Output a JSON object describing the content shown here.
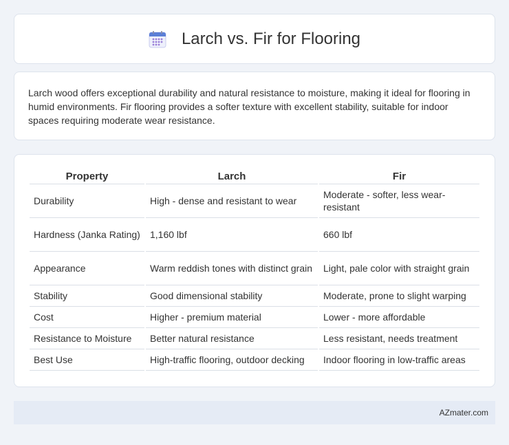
{
  "header": {
    "title": "Larch vs. Fir for Flooring",
    "icon": "calendar-icon"
  },
  "intro": {
    "text": "Larch wood offers exceptional durability and natural resistance to moisture, making it ideal for flooring in humid environments. Fir flooring provides a softer texture with excellent stability, suitable for indoor spaces requiring moderate wear resistance."
  },
  "table": {
    "headers": [
      "Property",
      "Larch",
      "Fir"
    ],
    "rows": [
      {
        "property": "Durability",
        "larch": "High - dense and resistant to wear",
        "fir": "Moderate - softer, less wear-resistant"
      },
      {
        "property": "Hardness (Janka Rating)",
        "larch": "1,160 lbf",
        "fir": "660 lbf"
      },
      {
        "property": "Appearance",
        "larch": "Warm reddish tones with distinct grain",
        "fir": "Light, pale color with straight grain"
      },
      {
        "property": "Stability",
        "larch": "Good dimensional stability",
        "fir": "Moderate, prone to slight warping"
      },
      {
        "property": "Cost",
        "larch": "Higher - premium material",
        "fir": "Lower - more affordable"
      },
      {
        "property": "Resistance to Moisture",
        "larch": "Better natural resistance",
        "fir": "Less resistant, needs treatment"
      },
      {
        "property": "Best Use",
        "larch": "High-traffic flooring, outdoor decking",
        "fir": "Indoor flooring in low-traffic areas"
      }
    ]
  },
  "footer": {
    "text": "AZmater.com"
  },
  "colors": {
    "background": "#f0f3f8",
    "card": "#ffffff",
    "footer_bg": "#e5ebf5",
    "icon_blue": "#5b7fd6",
    "icon_purple": "#9b7fd9"
  }
}
